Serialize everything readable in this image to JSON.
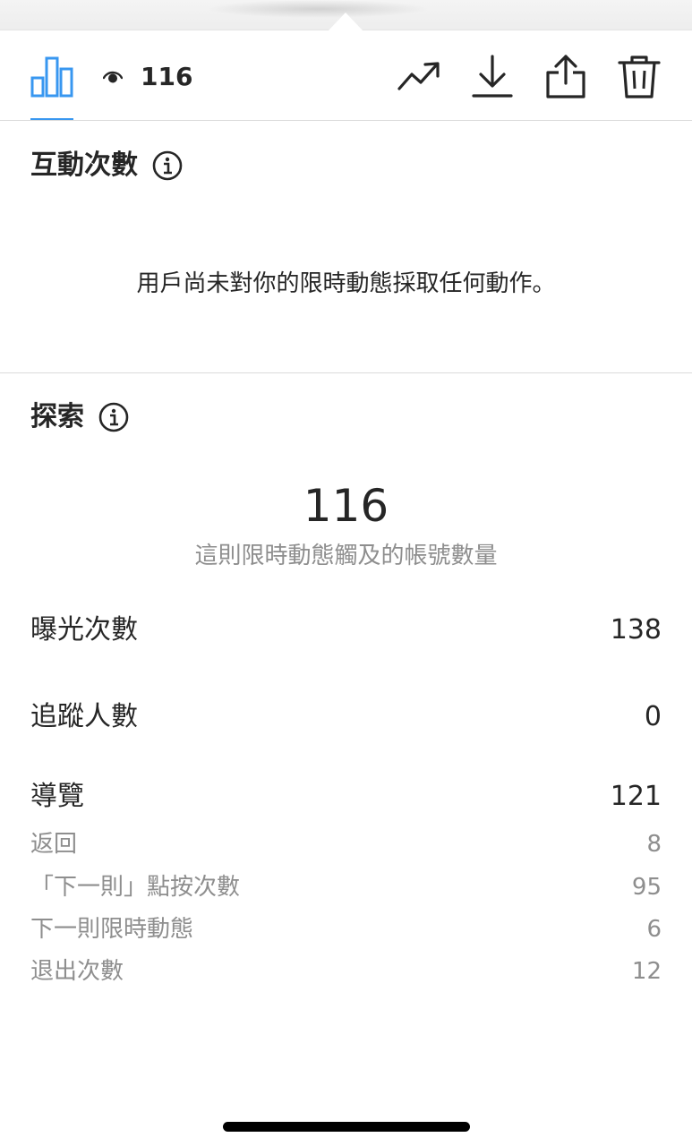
{
  "toolbar": {
    "views_count": "116",
    "icons": [
      "bar-chart-icon",
      "eye-icon",
      "trending-up-icon",
      "download-icon",
      "share-icon",
      "trash-icon"
    ],
    "accent_color": "#3897f0"
  },
  "interactions": {
    "title": "互動次數",
    "empty_message": "用戶尚未對你的限時動態採取任何動作。"
  },
  "discovery": {
    "title": "探索",
    "reach_value": "116",
    "reach_caption": "這則限時動態觸及的帳號數量",
    "rows": [
      {
        "label": "曝光次數",
        "value": "138"
      },
      {
        "label": "追蹤人數",
        "value": "0"
      },
      {
        "label": "導覽",
        "value": "121"
      }
    ],
    "navigation_breakdown": [
      {
        "label": "返回",
        "value": "8"
      },
      {
        "label": "「下一則」點按次數",
        "value": "95"
      },
      {
        "label": "下一則限時動態",
        "value": "6"
      },
      {
        "label": "退出次數",
        "value": "12"
      }
    ]
  }
}
